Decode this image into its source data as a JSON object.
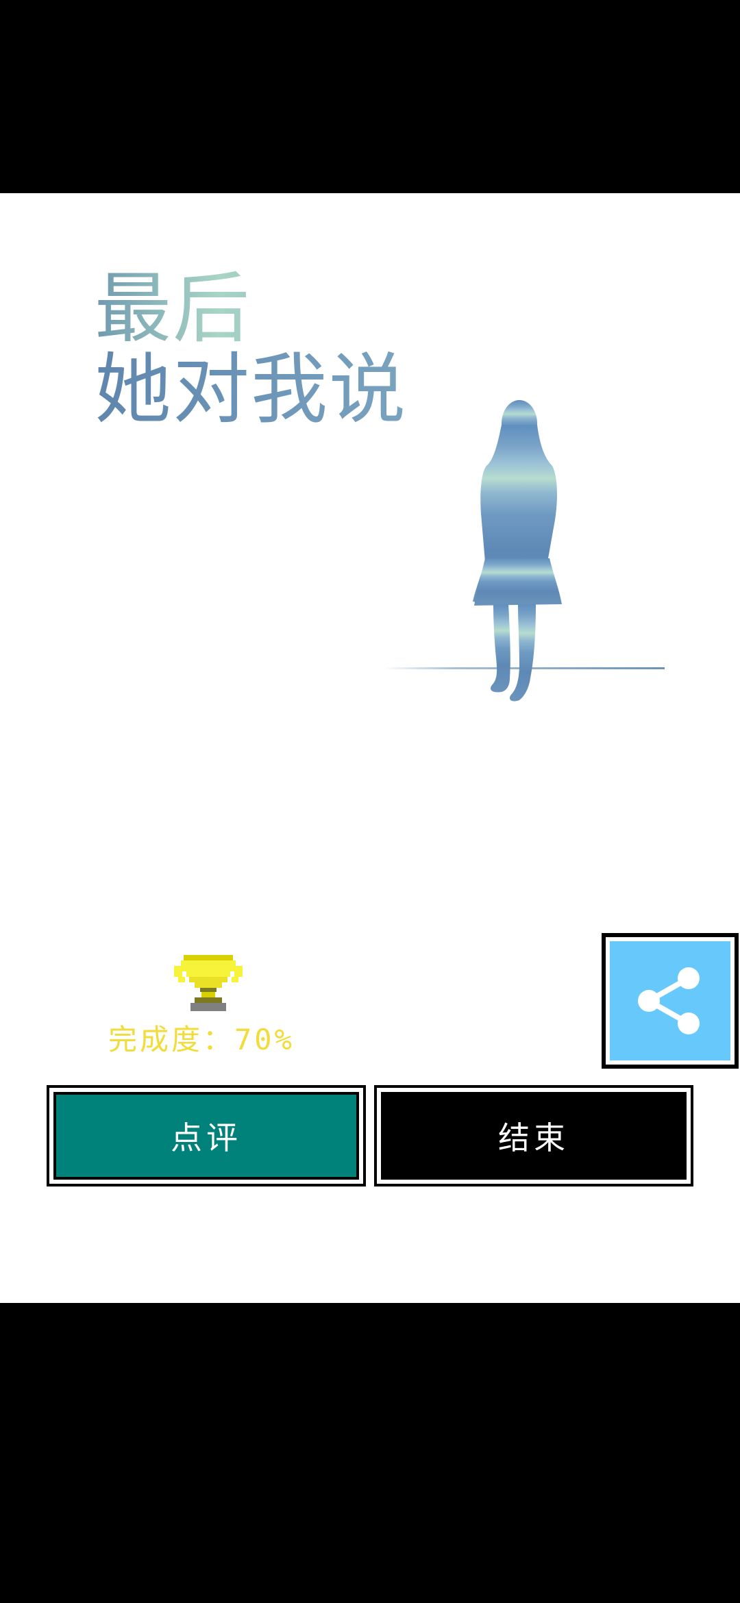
{
  "game": {
    "title_line1": "最后",
    "title_line2": "她对我说"
  },
  "result": {
    "completion_text": "完成度：70%",
    "completion_value": 0.7,
    "trophy_icon": "trophy-icon"
  },
  "share": {
    "icon": "share-icon",
    "color": "#67c9fb"
  },
  "buttons": {
    "review_label": "点评",
    "end_label": "结束",
    "review_color": "#00827a",
    "end_color": "#000000"
  }
}
